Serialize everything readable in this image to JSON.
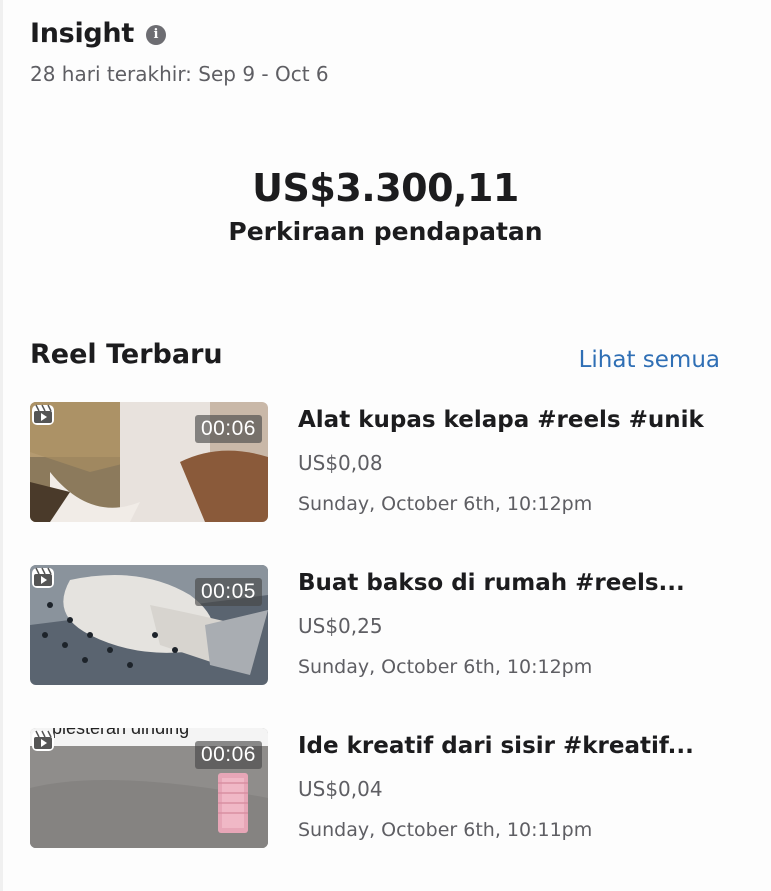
{
  "insight": {
    "title": "Insight",
    "info_icon": "info-icon",
    "date_range": "28 hari terakhir: Sep 9 - Oct 6"
  },
  "earnings": {
    "amount": "US$3.300,11",
    "label": "Perkiraan pendapatan"
  },
  "reels": {
    "section_title": "Reel Terbaru",
    "see_all": "Lihat semua",
    "items": [
      {
        "duration": "00:06",
        "title": "Alat kupas kelapa #reels #unik",
        "earning": "US$0,08",
        "date": "Sunday, October 6th, 10:12pm"
      },
      {
        "duration": "00:05",
        "title": "Buat bakso di rumah #reels...",
        "earning": "US$0,25",
        "date": "Sunday, October 6th, 10:12pm"
      },
      {
        "duration": "00:06",
        "title": "Ide kreatif dari sisir #kreatif...",
        "earning": "US$0,04",
        "date": "Sunday, October 6th, 10:11pm",
        "thumb_caption": "plesteran dinding"
      }
    ]
  },
  "colors": {
    "link": "#2f6fb5",
    "text_primary": "#1c1c1e",
    "text_secondary": "#5e5e63"
  }
}
